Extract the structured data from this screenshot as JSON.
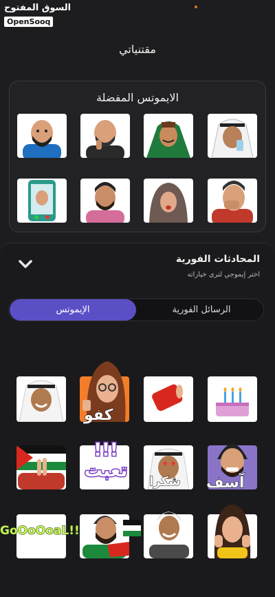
{
  "watermark": {
    "arabic": "السوق المفتوح",
    "latin": "OpenSooq"
  },
  "page": {
    "title": "مقتنياتي"
  },
  "favorites": {
    "title": "الايموتس المفضلة",
    "items": [
      "man-blue-shirt-sticker",
      "man-thinking-sticker",
      "man-green-scarf-sticker",
      "man-ghutra-drinking-sticker",
      "phone-call-sticker",
      "bearded-man-pink-sticker",
      "woman-hijab-sticker",
      "man-laughing-sticker"
    ]
  },
  "sheet": {
    "title": "المحادثات الفورية",
    "subtitle": "اختر إيموجي لترى خياراته",
    "tabs": [
      {
        "label": "الإيموتس",
        "active": true
      },
      {
        "label": "الرسائل الفورية",
        "active": false
      }
    ],
    "stickers": [
      {
        "name": "man-ghutra-smile-sticker",
        "caption": ""
      },
      {
        "name": "woman-thumbs-up-sticker",
        "caption": "كفو"
      },
      {
        "name": "red-can-sticker",
        "caption": ""
      },
      {
        "name": "birthday-cake-sticker",
        "caption": ""
      },
      {
        "name": "palestine-flag-victory-sticker",
        "caption": ""
      },
      {
        "name": "tired-text-sticker",
        "caption": "!!! تعبت"
      },
      {
        "name": "heart-eyes-thanks-sticker",
        "caption": "شكرا"
      },
      {
        "name": "sorry-man-sticker",
        "caption": "آسف"
      },
      {
        "name": "goal-text-sticker",
        "caption": "GoOoOoaL!!"
      },
      {
        "name": "bearded-man-flag-sticker",
        "caption": ""
      },
      {
        "name": "old-man-flag-sticker",
        "caption": ""
      },
      {
        "name": "woman-hands-face-sticker",
        "caption": ""
      }
    ]
  },
  "colors": {
    "background": "#1d1d1f",
    "accent": "#5b4fc6"
  }
}
